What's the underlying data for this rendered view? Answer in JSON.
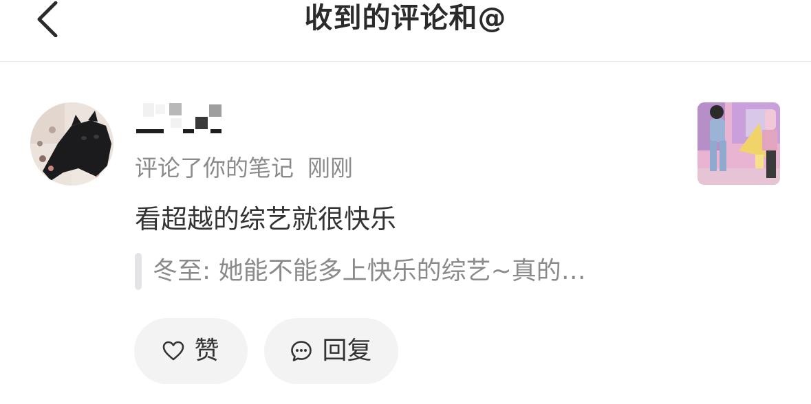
{
  "header": {
    "title": "收到的评论和@",
    "back_icon": "chevron-left-icon"
  },
  "notification": {
    "avatar_icon": "black-cat-avatar",
    "username": "",
    "action": "评论了你的笔记",
    "time": "刚刚",
    "comment": "看超越的综艺就很快乐",
    "quote": "冬至: 她能不能多上快乐的综艺~真的…",
    "thumbnail": "note-thumbnail-image"
  },
  "actions": {
    "like_label": "赞",
    "like_icon": "heart-outline-icon",
    "reply_label": "回复",
    "reply_icon": "chat-bubble-icon"
  },
  "colors": {
    "title": "#2b2b2b",
    "meta": "#8a8a8a",
    "body": "#333333",
    "button_bg": "#f3f3f4",
    "divider": "#e9e9ec"
  }
}
